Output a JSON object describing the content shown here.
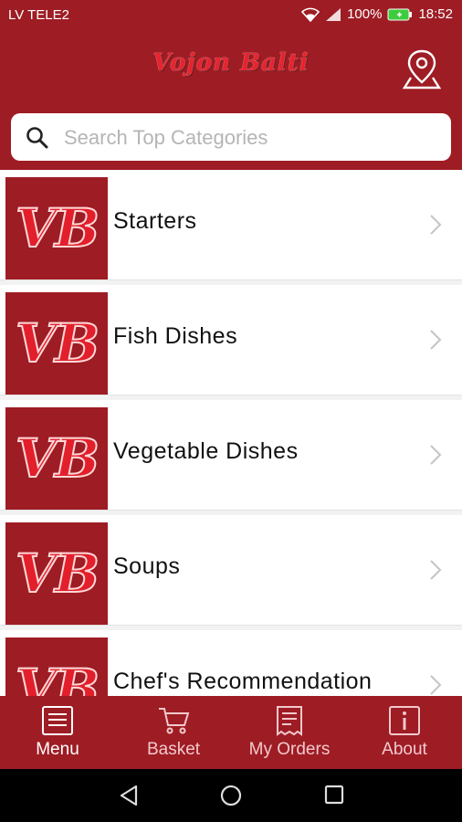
{
  "status_bar": {
    "carrier": "LV TELE2",
    "battery": "100%",
    "time": "18:52"
  },
  "header": {
    "brand": "Vojon Balti",
    "map_icon": "map-pin-icon"
  },
  "search": {
    "placeholder": "Search Top Categories",
    "value": ""
  },
  "categories": [
    {
      "label": "Starters",
      "logo_text": "VB"
    },
    {
      "label": "Fish Dishes",
      "logo_text": "VB"
    },
    {
      "label": "Vegetable Dishes",
      "logo_text": "VB"
    },
    {
      "label": "Soups",
      "logo_text": "VB"
    },
    {
      "label": "Chef's Recommendation",
      "logo_text": "VB"
    }
  ],
  "tabs": [
    {
      "label": "Menu",
      "icon": "menu-list-icon",
      "active": true
    },
    {
      "label": "Basket",
      "icon": "cart-icon",
      "active": false
    },
    {
      "label": "My Orders",
      "icon": "receipt-icon",
      "active": false
    },
    {
      "label": "About",
      "icon": "info-icon",
      "active": false
    }
  ],
  "colors": {
    "primary": "#9e1c24",
    "logo_red": "#e21f2b"
  }
}
